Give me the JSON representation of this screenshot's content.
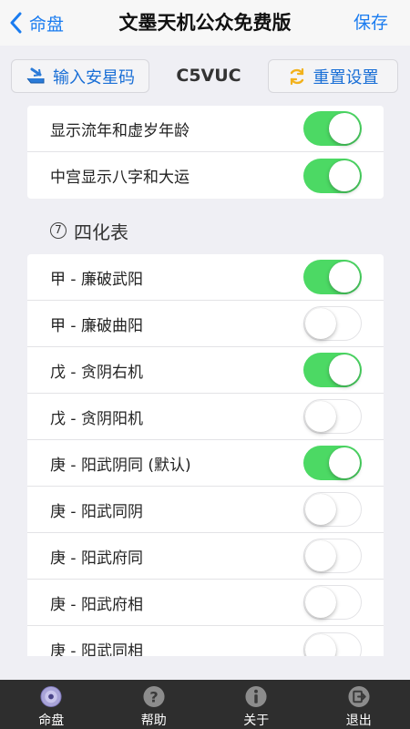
{
  "nav": {
    "back_label": "命盘",
    "title": "文墨天机公众免费版",
    "save_label": "保存"
  },
  "toolbar": {
    "input_label": "输入安星码",
    "code": "C5VUC",
    "reset_label": "重置设置"
  },
  "group_top": [
    {
      "label": "显示流年和虚岁年龄",
      "on": true
    },
    {
      "label": "中宫显示八字和大运",
      "on": true
    }
  ],
  "section": {
    "number": "7",
    "title": "四化表"
  },
  "sihua_rows": [
    {
      "label": "甲 - 廉破武阳",
      "on": true
    },
    {
      "label": "甲 - 廉破曲阳",
      "on": false
    },
    {
      "label": "戊 - 贪阴右机",
      "on": true
    },
    {
      "label": "戊 - 贪阴阳机",
      "on": false
    },
    {
      "label": "庚 - 阳武阴同 (默认)",
      "on": true
    },
    {
      "label": "庚 - 阳武同阴",
      "on": false
    },
    {
      "label": "庚 - 阳武府同",
      "on": false
    },
    {
      "label": "庚 - 阳武府相",
      "on": false
    },
    {
      "label": "庚 - 阳武同相",
      "on": false
    }
  ],
  "tabs": [
    {
      "label": "命盘",
      "icon": "disc-icon"
    },
    {
      "label": "帮助",
      "icon": "help-icon"
    },
    {
      "label": "关于",
      "icon": "info-icon"
    },
    {
      "label": "退出",
      "icon": "exit-icon"
    }
  ],
  "colors": {
    "accent": "#1a7cf0",
    "switch_on": "#4cd964",
    "tabbar": "#2e2e2e"
  }
}
